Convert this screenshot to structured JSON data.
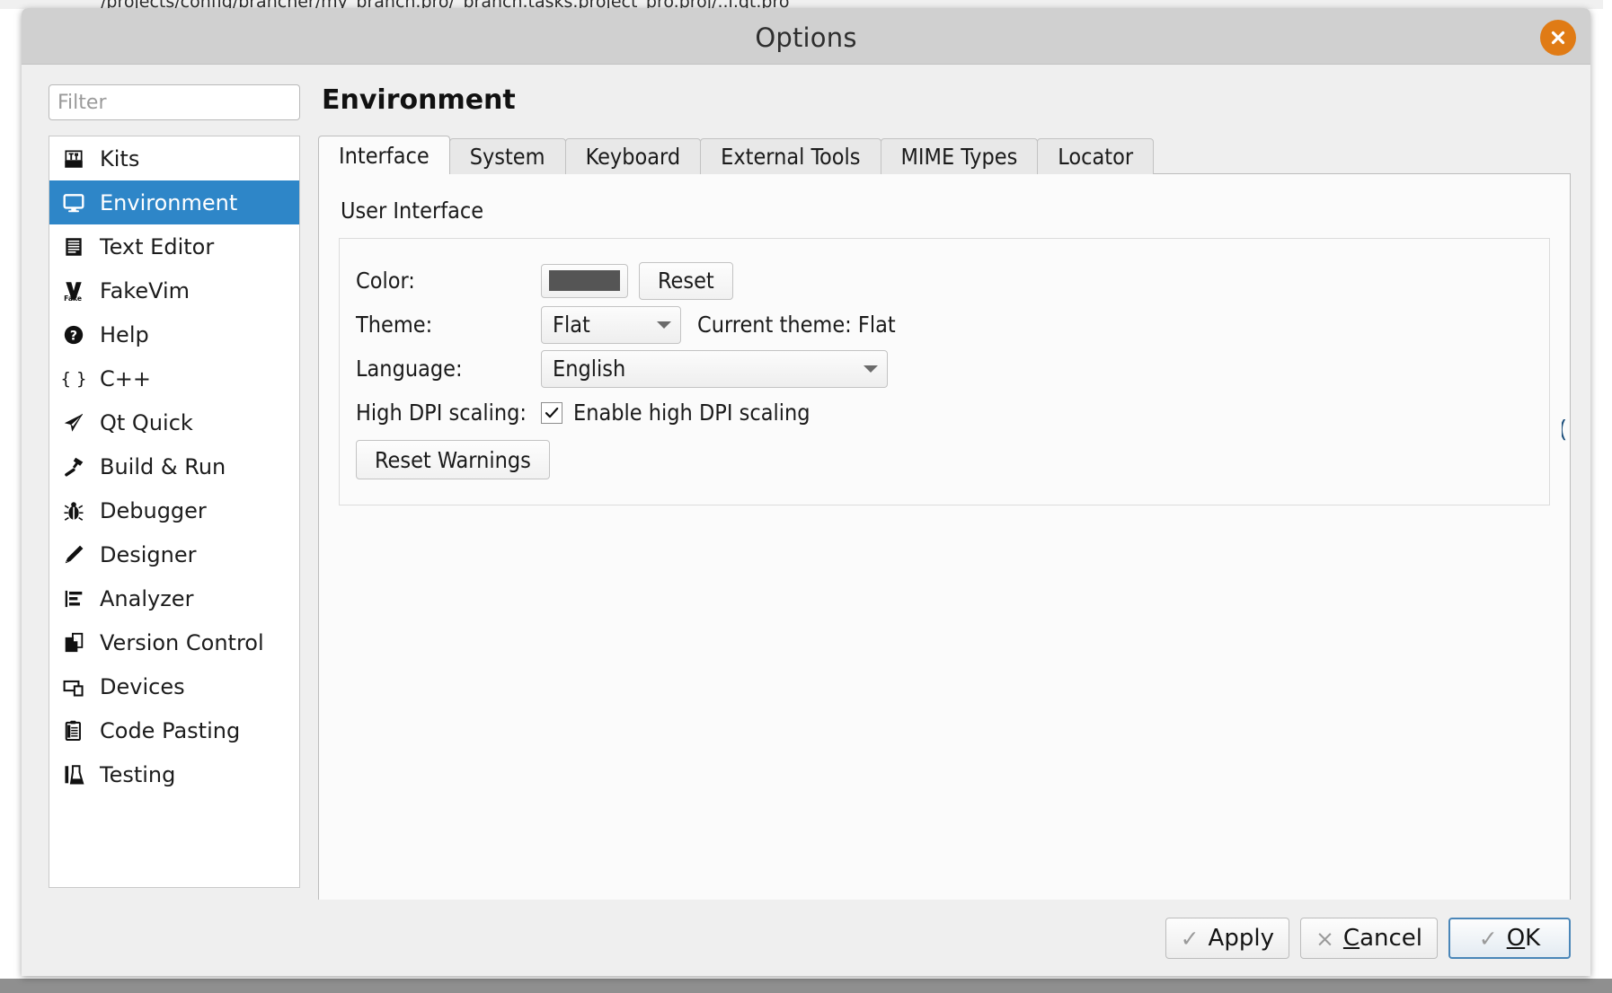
{
  "backdrop": {
    "ghost_text": "/projects/config/brancher/my_branch.pro/_branch.tasks.project_pro.proj/..i.qt.pro"
  },
  "window": {
    "title": "Options",
    "close_icon": "close-x-icon"
  },
  "sidebar": {
    "filter_placeholder": "Filter",
    "filter_value": "",
    "items": [
      {
        "label": "Kits",
        "icon": "kits-icon",
        "selected": false
      },
      {
        "label": "Environment",
        "icon": "monitor-icon",
        "selected": true
      },
      {
        "label": "Text Editor",
        "icon": "text-lines-icon",
        "selected": false
      },
      {
        "label": "FakeVim",
        "icon": "fakevim-icon",
        "selected": false
      },
      {
        "label": "Help",
        "icon": "question-circle-icon",
        "selected": false
      },
      {
        "label": "C++",
        "icon": "braces-icon",
        "selected": false
      },
      {
        "label": "Qt Quick",
        "icon": "paper-plane-icon",
        "selected": false
      },
      {
        "label": "Build & Run",
        "icon": "hammer-icon",
        "selected": false
      },
      {
        "label": "Debugger",
        "icon": "bug-icon",
        "selected": false
      },
      {
        "label": "Designer",
        "icon": "pencil-icon",
        "selected": false
      },
      {
        "label": "Analyzer",
        "icon": "bar-analysis-icon",
        "selected": false
      },
      {
        "label": "Version Control",
        "icon": "documents-icon",
        "selected": false
      },
      {
        "label": "Devices",
        "icon": "devices-icon",
        "selected": false
      },
      {
        "label": "Code Pasting",
        "icon": "clipboard-icon",
        "selected": false
      },
      {
        "label": "Testing",
        "icon": "test-tube-icon",
        "selected": false
      }
    ]
  },
  "page": {
    "heading": "Environment",
    "tabs": [
      {
        "label": "Interface",
        "active": true
      },
      {
        "label": "System",
        "active": false
      },
      {
        "label": "Keyboard",
        "active": false
      },
      {
        "label": "External Tools",
        "active": false
      },
      {
        "label": "MIME Types",
        "active": false
      },
      {
        "label": "Locator",
        "active": false
      }
    ],
    "group_title": "User Interface",
    "form": {
      "color_label": "Color:",
      "color_value": "#555555",
      "reset_label": "Reset",
      "theme_label": "Theme:",
      "theme_value": "Flat",
      "current_theme_text": "Current theme: Flat",
      "language_label": "Language:",
      "language_value": "English",
      "dpi_label": "High DPI scaling:",
      "dpi_checkbox_label": "Enable high DPI scaling",
      "dpi_checked": true,
      "reset_warnings_label": "Reset Warnings"
    }
  },
  "footer": {
    "apply_label": "Apply",
    "apply_glyph": "✓",
    "cancel_glyph": "×",
    "cancel_accel": "C",
    "cancel_rest": "ancel",
    "ok_glyph": "✓",
    "ok_accel": "O",
    "ok_rest": "K"
  },
  "colors": {
    "selection_blue": "#2e86c8",
    "close_orange": "#e07b15",
    "dialog_bg": "#efefef",
    "titlebar_bg": "#d0d0d0",
    "panel_bg": "#fbfbfb"
  }
}
